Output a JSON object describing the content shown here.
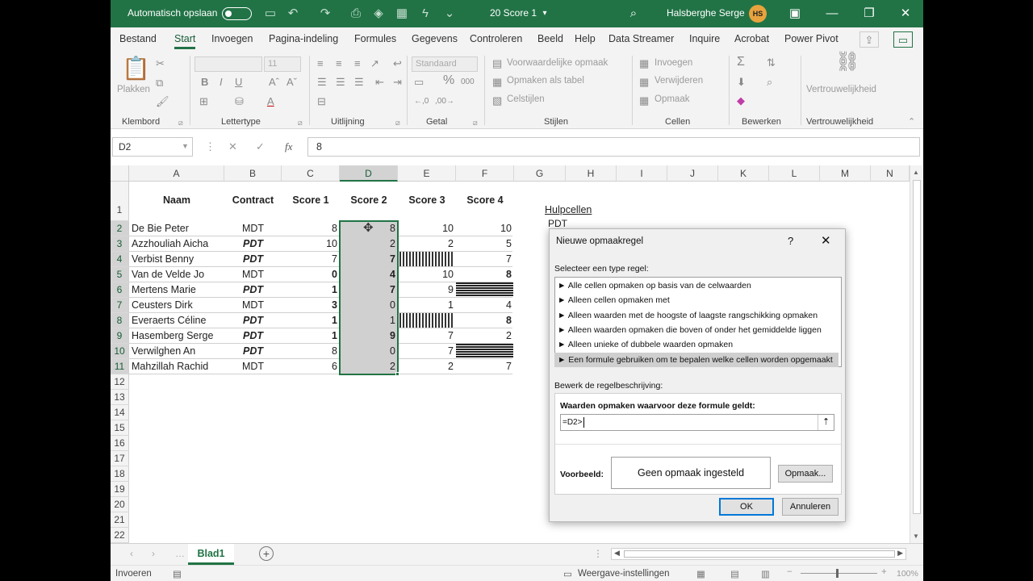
{
  "titlebar": {
    "autosave_label": "Automatisch opslaan",
    "filename": "20 Score 1",
    "user_name": "Halsberghe Serge",
    "user_initials": "HS"
  },
  "menu": {
    "items": [
      "Bestand",
      "Start",
      "Invoegen",
      "Pagina-indeling",
      "Formules",
      "Gegevens",
      "Controleren",
      "Beeld",
      "Help",
      "Data Streamer",
      "Inquire",
      "Acrobat",
      "Power Pivot"
    ]
  },
  "ribbon": {
    "clipboard": {
      "paste": "Plakken",
      "label": "Klembord"
    },
    "font": {
      "name": "",
      "size": "11",
      "bold": "B",
      "italic": "I",
      "underline": "U",
      "label": "Lettertype"
    },
    "alignment": {
      "label": "Uitlijning"
    },
    "number": {
      "format": "Standaard",
      "percent": "%",
      "thousands": "000",
      "label": "Getal"
    },
    "styles": {
      "conditional": "Voorwaardelijke opmaak",
      "as_table": "Opmaken als tabel",
      "cell_styles": "Celstijlen",
      "label": "Stijlen"
    },
    "cells": {
      "insert": "Invoegen",
      "delete": "Verwijderen",
      "format": "Opmaak",
      "label": "Cellen"
    },
    "editing": {
      "label": "Bewerken"
    },
    "sensitivity": {
      "button": "Vertrouwelijkheid",
      "label": "Vertrouwelijkheid"
    }
  },
  "formula_bar": {
    "name_box": "D2",
    "content": "8"
  },
  "columns": [
    "A",
    "B",
    "C",
    "D",
    "E",
    "F",
    "G",
    "H",
    "I",
    "J",
    "K",
    "L",
    "M",
    "N"
  ],
  "rows": [
    "1",
    "2",
    "3",
    "4",
    "5",
    "6",
    "7",
    "8",
    "9",
    "10",
    "11",
    "12",
    "13",
    "14",
    "15",
    "16",
    "17",
    "18",
    "19",
    "20",
    "21",
    "22"
  ],
  "table": {
    "headers": [
      "Naam",
      "Contract",
      "Score 1",
      "Score 2",
      "Score 3",
      "Score 4"
    ],
    "rows": [
      {
        "name": "De Bie Peter",
        "contract": "MDT",
        "s1": "8",
        "s2": "8",
        "s3": "10",
        "s4": "10",
        "pdt": false,
        "b1": false,
        "b2": false,
        "b4": false
      },
      {
        "name": "Azzhouliah Aicha",
        "contract": "PDT",
        "s1": "10",
        "s2": "2",
        "s3": "2",
        "s4": "5",
        "pdt": true,
        "b1": false,
        "b2": false,
        "b4": false
      },
      {
        "name": "Verbist Benny",
        "contract": "PDT",
        "s1": "7",
        "s2": "7",
        "s3": "",
        "s4": "7",
        "pdt": true,
        "b1": false,
        "b2": true,
        "b4": false,
        "e_bar": "v"
      },
      {
        "name": "Van de Velde Jo",
        "contract": "MDT",
        "s1": "0",
        "s2": "4",
        "s3": "10",
        "s4": "8",
        "pdt": false,
        "b1": true,
        "b2": true,
        "b4": true
      },
      {
        "name": "Mertens Marie",
        "contract": "PDT",
        "s1": "1",
        "s2": "7",
        "s3": "9",
        "s4": "",
        "pdt": true,
        "b1": true,
        "b2": true,
        "b4": false,
        "f_bar": "h"
      },
      {
        "name": "Ceusters Dirk",
        "contract": "MDT",
        "s1": "3",
        "s2": "0",
        "s3": "1",
        "s4": "4",
        "pdt": false,
        "b1": true,
        "b2": false,
        "b4": false
      },
      {
        "name": "Everaerts Céline",
        "contract": "PDT",
        "s1": "1",
        "s2": "1",
        "s3": "",
        "s4": "8",
        "pdt": true,
        "b1": true,
        "b2": false,
        "b4": true,
        "e_bar": "v"
      },
      {
        "name": "Hasemberg Serge",
        "contract": "PDT",
        "s1": "1",
        "s2": "9",
        "s3": "7",
        "s4": "2",
        "pdt": true,
        "b1": true,
        "b2": true,
        "b4": false
      },
      {
        "name": "Verwilghen An",
        "contract": "PDT",
        "s1": "8",
        "s2": "0",
        "s3": "7",
        "s4": "",
        "pdt": true,
        "b1": false,
        "b2": false,
        "b4": false,
        "f_bar": "h"
      },
      {
        "name": "Mahzillah Rachid",
        "contract": "MDT",
        "s1": "6",
        "s2": "2",
        "s3": "2",
        "s4": "7",
        "pdt": false,
        "b1": false,
        "b2": false,
        "b4": false
      }
    ]
  },
  "helper": {
    "title": "Hulpcellen",
    "value": "PDT"
  },
  "sheet_tabs": {
    "active": "Blad1"
  },
  "status": {
    "mode": "Invoeren",
    "display_settings": "Weergave-instellingen",
    "zoom": "100%"
  },
  "dialog": {
    "title": "Nieuwe opmaakregel",
    "help": "?",
    "select_label": "Selecteer een type regel:",
    "rule_types": [
      "► Alle cellen opmaken op basis van de celwaarden",
      "► Alleen cellen opmaken met",
      "► Alleen waarden met de hoogste of laagste rangschikking opmaken",
      "► Alleen waarden opmaken die boven of onder het gemiddelde liggen",
      "► Alleen unieke of dubbele waarden opmaken",
      "► Een formule gebruiken om te bepalen welke cellen worden opgemaakt"
    ],
    "edit_label": "Bewerk de regelbeschrijving:",
    "formula_label": "Waarden opmaken waarvoor deze formule geldt:",
    "formula_value": "=D2>",
    "preview_label": "Voorbeeld:",
    "preview_text": "Geen opmaak ingesteld",
    "format_button": "Opmaak...",
    "ok": "OK",
    "cancel": "Annuleren"
  },
  "colors": {
    "accent": "#217346",
    "selection": "#d0d0d0"
  }
}
